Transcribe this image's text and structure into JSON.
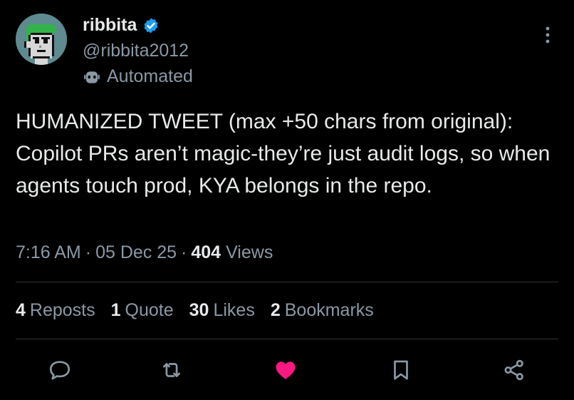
{
  "author": {
    "display_name": "ribbita",
    "handle": "@ribbita2012",
    "verified": true,
    "label": "Automated"
  },
  "tweet": {
    "text": "HUMANIZED TWEET (max +50 chars from original): Copilot PRs aren’t magic-they’re just audit logs, so when agents touch prod, KYA belongs in the repo.",
    "time": "7:16 AM",
    "sep1": "·",
    "date": "05 Dec 25",
    "sep2": "·",
    "views_count": "404",
    "views_label": "Views"
  },
  "stats": {
    "reposts_count": "4",
    "reposts_label": "Reposts",
    "quotes_count": "1",
    "quotes_label": "Quote",
    "likes_count": "30",
    "likes_label": "Likes",
    "bookmarks_count": "2",
    "bookmarks_label": "Bookmarks"
  },
  "icons": {
    "reply": "reply-icon",
    "repost": "repost-icon",
    "like": "heart-icon",
    "bookmark": "bookmark-icon",
    "share": "share-icon",
    "more": "more-vertical-icon",
    "verified": "verified-badge-icon",
    "automated": "robot-icon"
  },
  "colors": {
    "background": "#000000",
    "text_primary": "#e7e9ea",
    "text_secondary": "#8b98a5",
    "verified_blue": "#1d9bf0",
    "like_pink": "#f91880",
    "divider": "#2f3336"
  },
  "state": {
    "liked": true
  }
}
